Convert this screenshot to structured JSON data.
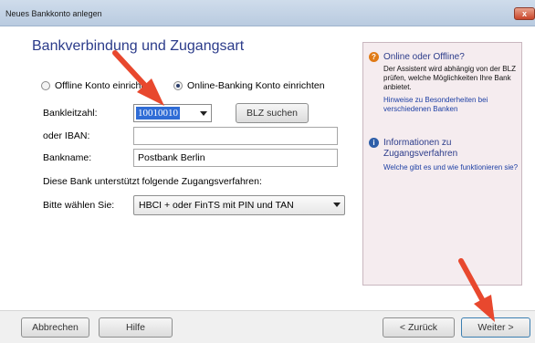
{
  "window": {
    "title": "Neues Bankkonto anlegen",
    "close_glyph": "x"
  },
  "page": {
    "heading": "Bankverbindung und Zugangsart"
  },
  "mode": {
    "offline_label": "Offline Konto einrichten",
    "online_label": "Online-Banking Konto einrichten",
    "selected": "online"
  },
  "form": {
    "blz_label": "Bankleitzahl:",
    "blz_value": "10010010",
    "blz_search_button": "BLZ suchen",
    "iban_label": "oder IBAN:",
    "iban_value": "",
    "bankname_label": "Bankname:",
    "bankname_value": "Postbank Berlin",
    "procedures_note": "Diese Bank unterstützt folgende Zugangsverfahren:",
    "choose_label": "Bitte wählen Sie:",
    "procedure_value": "HBCI + oder FinTS mit PIN und TAN"
  },
  "info": {
    "sec1_title": "Online oder Offline?",
    "sec1_text": "Der Assistent wird abhängig von der BLZ prüfen, welche Möglichkeiten Ihre Bank anbietet.",
    "sec1_link": "Hinweise zu Besonderheiten bei verschiedenen Banken",
    "sec2_title": "Informationen zu Zugangsverfahren",
    "sec2_link": "Welche gibt es und wie funktionieren sie?"
  },
  "footer": {
    "cancel": "Abbrechen",
    "help": "Hilfe",
    "back": "< Zurück",
    "next": "Weiter >"
  },
  "accent_colors": {
    "heading": "#2b3b8a",
    "annotation_arrow": "#e8482e",
    "selection": "#2f6cd6"
  }
}
